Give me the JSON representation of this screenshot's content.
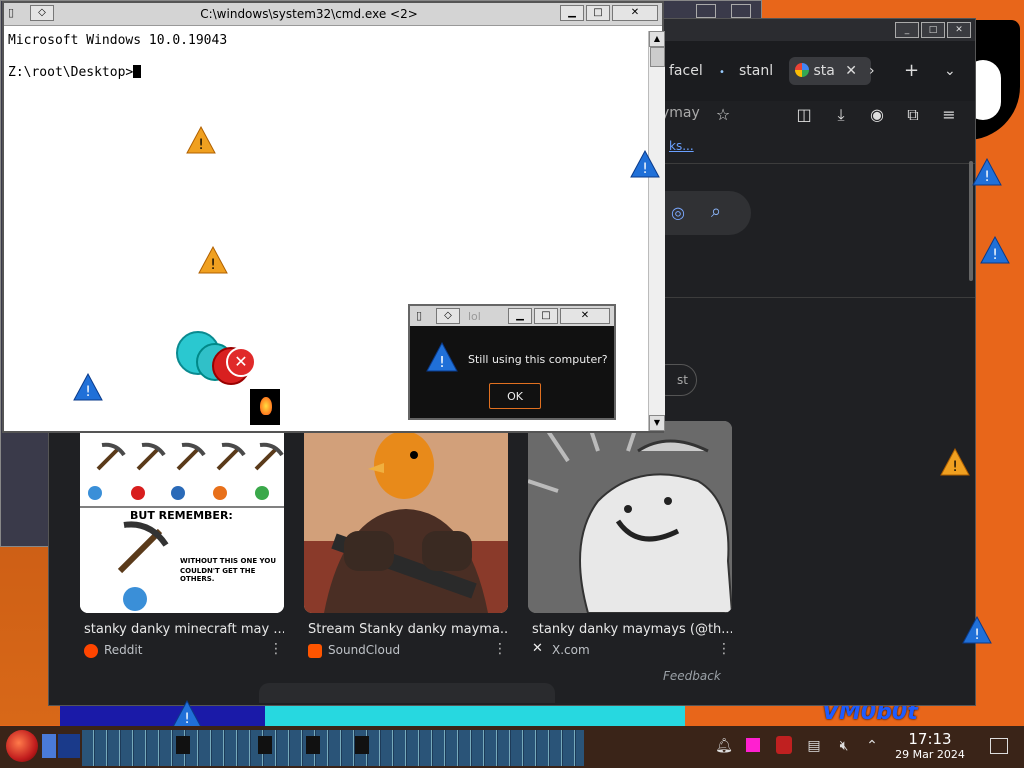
{
  "cmd": {
    "title": "C:\\windows\\system32\\cmd.exe <2>",
    "line1": "Microsoft Windows 10.0.19043",
    "prompt": "Z:\\root\\Desktop>"
  },
  "browser": {
    "tabs": [
      {
        "label": "facel"
      },
      {
        "label": "stanl"
      },
      {
        "label": "sta"
      }
    ],
    "address_fragment": "ymay",
    "link_fragment": "ks...",
    "chip_fragment": "st",
    "results": [
      {
        "title": "stanky danky minecraft may ...",
        "source": "Reddit",
        "icon_color": "#ff4500"
      },
      {
        "title": "Stream Stanky danky mayma...",
        "source": "SoundCloud",
        "icon_color": "#ff5500"
      },
      {
        "title": "stanky danky maymays (@th...",
        "source": "X.com",
        "icon_color": "#000000"
      }
    ],
    "feedback": "Feedback"
  },
  "dialog": {
    "title": "lol",
    "message": "Still using this computer?",
    "ok_label": "OK"
  },
  "meme1": {
    "remember": "BUT REMEMBER:",
    "caption_line1": "WITHOUT THIS ONE YOU",
    "caption_line2": "COULDN'T GET THE OTHERS."
  },
  "wallpaper": {
    "text": "VM0b0t"
  },
  "taskbar": {
    "time": "17:13",
    "date": "29 Mar 2024"
  }
}
